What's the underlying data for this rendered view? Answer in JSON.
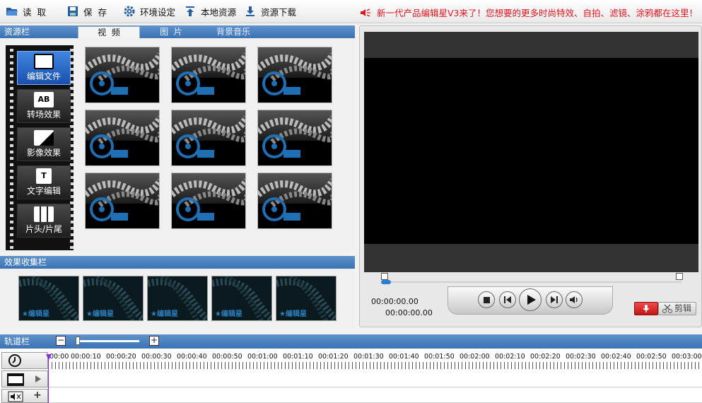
{
  "toolbar": {
    "items": [
      {
        "label": "读  取",
        "icon": "folder-open-icon"
      },
      {
        "label": "保  存",
        "icon": "save-icon"
      },
      {
        "label": "环境设定",
        "icon": "gear-icon"
      },
      {
        "label": "本地资源",
        "icon": "upload-icon"
      },
      {
        "label": "资源下载",
        "icon": "download-icon"
      }
    ],
    "announcement": "新一代产品编辑星V3来了！您想要的更多时尚特效、自拍、滤镜、涂鸦都在这里！"
  },
  "resource_panel": {
    "title": "资源栏",
    "tabs": [
      "视  频",
      "图  片",
      "背景音乐"
    ],
    "active_tab": 0,
    "categories": [
      {
        "label": "编辑文件",
        "icon": "edit-file-icon",
        "glyph": ""
      },
      {
        "label": "转场效果",
        "icon": "transition-icon",
        "glyph": "AB"
      },
      {
        "label": "影像效果",
        "icon": "image-effect-icon",
        "glyph": ""
      },
      {
        "label": "文字编辑",
        "icon": "text-edit-icon",
        "glyph": "T"
      },
      {
        "label": "片头/片尾",
        "icon": "title-credits-icon",
        "glyph": ""
      }
    ]
  },
  "effects_panel": {
    "title": "效果收集栏",
    "thumb_label": "★编辑星"
  },
  "player": {
    "current_time": "00:00:00.00",
    "total_time": "00:00:00.00",
    "cut_label": "剪辑"
  },
  "track_panel": {
    "title": "轨道栏",
    "zoom_out": "−",
    "zoom_in": "+",
    "add": "+",
    "ruler": [
      "00:00",
      "00:00:10",
      "00:00:20",
      "00:00:30",
      "00:00:40",
      "00:00:50",
      "00:01:00",
      "00:01:10",
      "00:01:20",
      "00:01:30",
      "00:01:40",
      "00:01:50",
      "00:02:00",
      "00:02:10",
      "00:02:20",
      "00:02:30",
      "00:02:40",
      "00:02:50",
      "00:03:00"
    ]
  },
  "colors": {
    "accent": "#3a72b3",
    "announcement": "#e0141e",
    "reel": "#1e6fb4",
    "playhead": "#8a2be2"
  }
}
